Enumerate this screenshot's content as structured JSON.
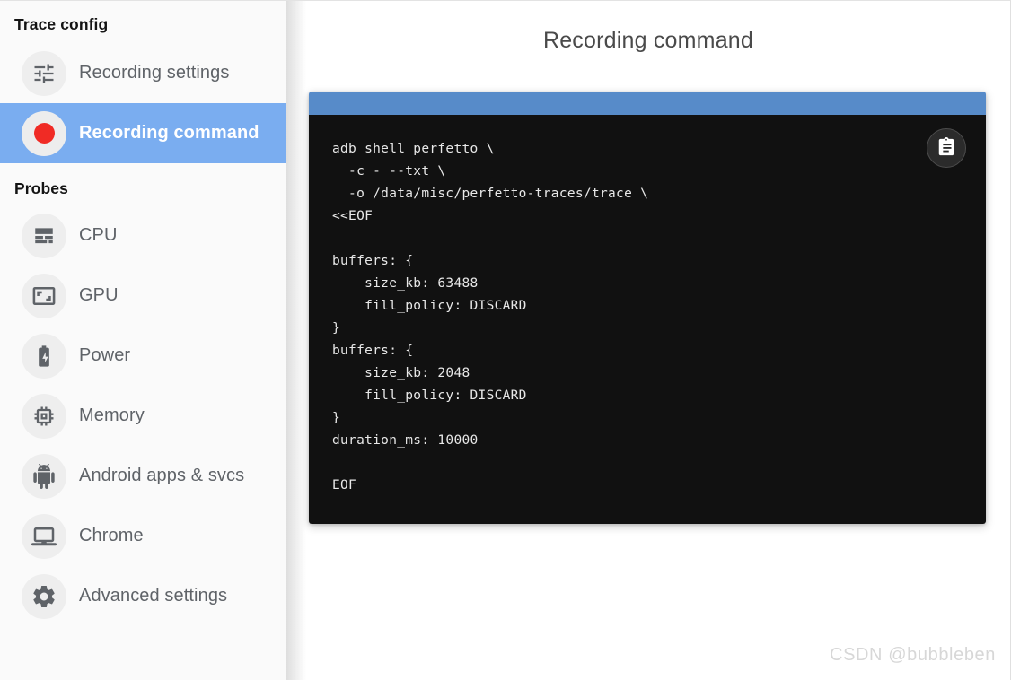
{
  "sidebar": {
    "trace_config_title": "Trace config",
    "probes_title": "Probes",
    "nav_items": [
      {
        "label": "Recording settings",
        "icon": "tune-icon",
        "selected": false
      },
      {
        "label": "Recording command",
        "icon": "record-icon",
        "selected": true
      }
    ],
    "probe_items": [
      {
        "label": "CPU",
        "icon": "cpu-icon"
      },
      {
        "label": "GPU",
        "icon": "gpu-icon"
      },
      {
        "label": "Power",
        "icon": "battery-charging-icon"
      },
      {
        "label": "Memory",
        "icon": "memory-chip-icon"
      },
      {
        "label": "Android apps & svcs",
        "icon": "android-icon"
      },
      {
        "label": "Chrome",
        "icon": "laptop-icon"
      },
      {
        "label": "Advanced settings",
        "icon": "gear-icon"
      }
    ]
  },
  "main": {
    "page_title": "Recording command",
    "copy_button_label": "",
    "copy_button_icon": "clipboard-icon",
    "command": "adb shell perfetto \\\n  -c - --txt \\\n  -o /data/misc/perfetto-traces/trace \\\n<<EOF\n\nbuffers: {\n    size_kb: 63488\n    fill_policy: DISCARD\n}\nbuffers: {\n    size_kb: 2048\n    fill_policy: DISCARD\n}\nduration_ms: 10000\n\nEOF"
  },
  "watermark": {
    "text": "CSDN @bubbleben"
  },
  "colors": {
    "accent_blue": "#578bc9",
    "selected_row": "#7aadf0",
    "record_red": "#f02b25",
    "code_bg": "#111111",
    "sidebar_bg": "#fafafa",
    "icon_gray": "#5f6368"
  }
}
